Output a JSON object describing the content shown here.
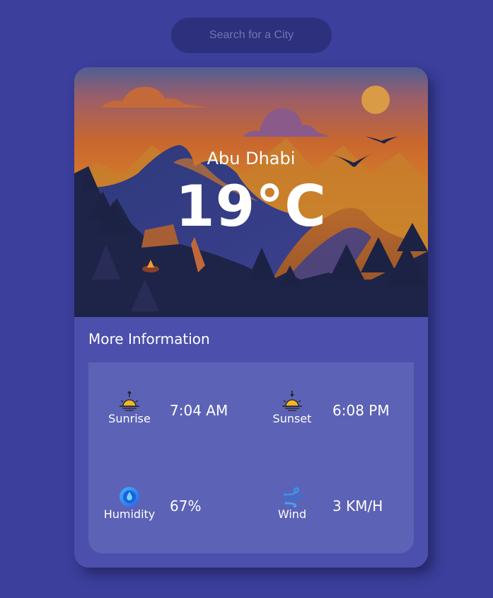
{
  "search": {
    "placeholder": "Search for a City"
  },
  "weather": {
    "city": "Abu Dhabi",
    "temperature": "19°C"
  },
  "more_info": {
    "title": "More Information",
    "items": [
      {
        "icon": "sunrise-icon",
        "label": "Sunrise",
        "value": "7:04 AM"
      },
      {
        "icon": "sunset-icon",
        "label": "Sunset",
        "value": "6:08 PM"
      },
      {
        "icon": "humidity-icon",
        "label": "Humidity",
        "value": "67%"
      },
      {
        "icon": "wind-icon",
        "label": "Wind",
        "value": "3 KM/H"
      }
    ]
  },
  "colors": {
    "background": "#3c3f9b",
    "card": "#4c50ac",
    "info_panel": "#5c62b5",
    "search": "#2d307d"
  }
}
